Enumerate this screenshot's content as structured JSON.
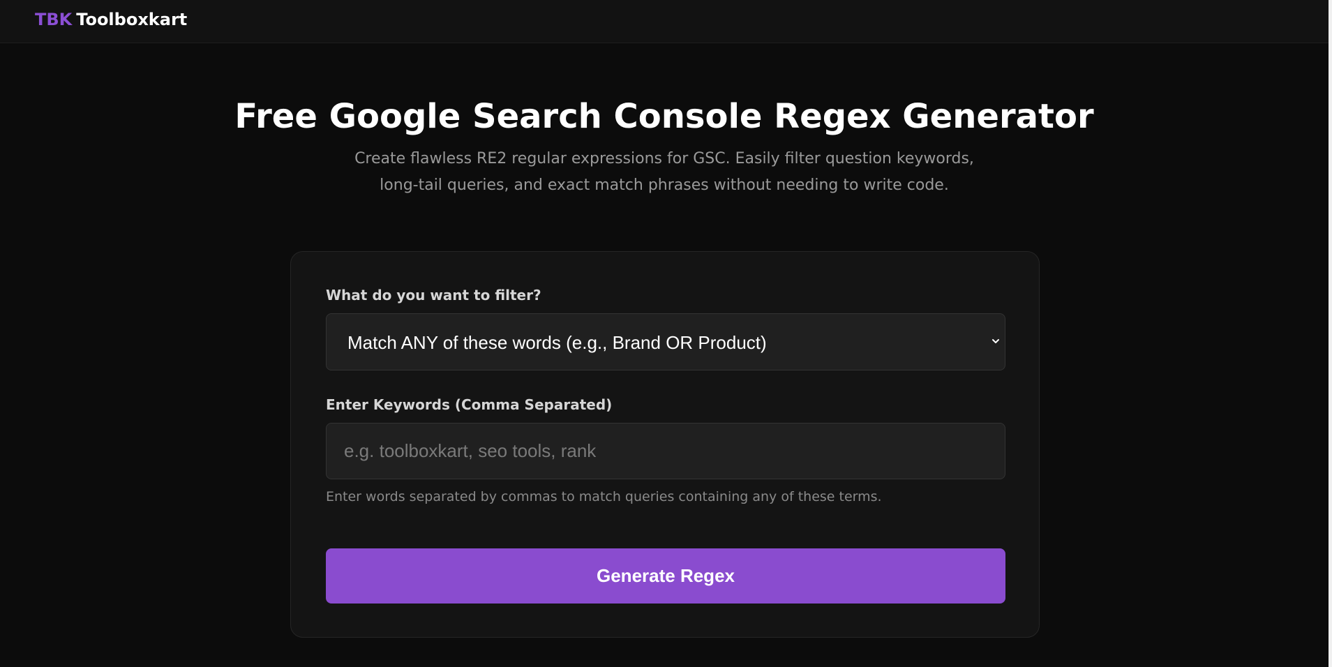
{
  "header": {
    "logo_mark": "TBK",
    "logo_text": "Toolboxkart"
  },
  "hero": {
    "title": "Free Google Search Console Regex Generator",
    "subtitle": "Create flawless RE2 regular expressions for GSC. Easily filter question keywords, long-tail queries, and exact match phrases without needing to write code."
  },
  "form": {
    "filter_label": "What do you want to filter?",
    "filter_selected": "Match ANY of these words (e.g., Brand OR Product)",
    "keywords_label": "Enter Keywords (Comma Separated)",
    "keywords_value": "",
    "keywords_placeholder": "e.g. toolboxkart, seo tools, rank",
    "help_text": "Enter words separated by commas to match queries containing any of these terms.",
    "generate_label": "Generate Regex"
  },
  "icons": {
    "select_arrow": "chevron-down-icon"
  },
  "colors": {
    "accent": "#8a4ccf",
    "logo_mark": "#8b4fd4",
    "page_background": "#0c0c0c",
    "card_background": "#141414",
    "field_background": "#202020"
  }
}
